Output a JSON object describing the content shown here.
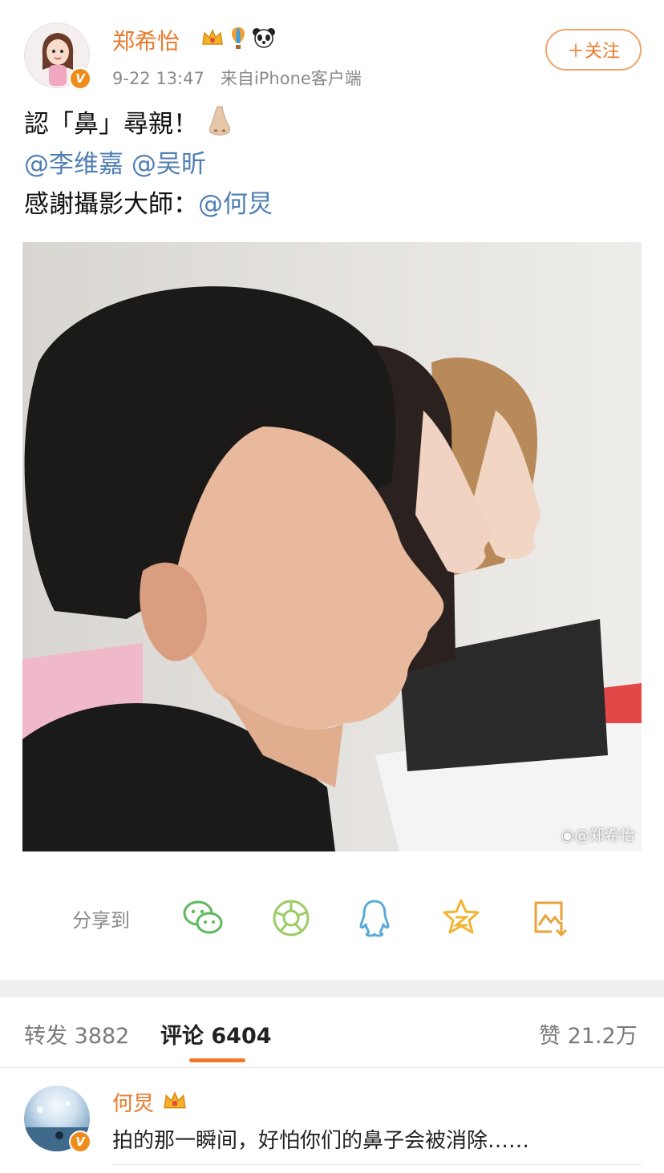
{
  "post": {
    "author": "郑希怡",
    "badges": [
      "crown-icon",
      "hot-air-balloon-icon",
      "panda-icon"
    ],
    "time": "9-22 13:47",
    "source": "来自iPhone客户端",
    "follow_label": "＋关注",
    "text_line1": "認「鼻」尋親！",
    "mention1": "@李维嘉",
    "mention2": "@吴昕",
    "text_line3": "感謝攝影大師：",
    "mention3": "@何炅",
    "photo_watermark": "@郑希怡"
  },
  "share": {
    "label": "分享到",
    "targets": [
      "wechat-icon",
      "moments-icon",
      "qq-icon",
      "qzone-icon",
      "save-image-icon"
    ],
    "colors": {
      "wechat": "#5cb85c",
      "moments": "#9ccc65",
      "qq": "#5aa9d6",
      "qzone": "#f2b431",
      "save": "#e8a33a"
    }
  },
  "tabs": {
    "repost": "转发 3882",
    "comment": "评论 6404",
    "like": "赞 21.2万"
  },
  "comment": {
    "author": "何炅",
    "text": "拍的那一瞬间，好怕你们的鼻子会被消除……"
  },
  "colors": {
    "accent": "#e8792a",
    "link": "#4f7fb3",
    "tab_underline": "#f07a2a"
  }
}
